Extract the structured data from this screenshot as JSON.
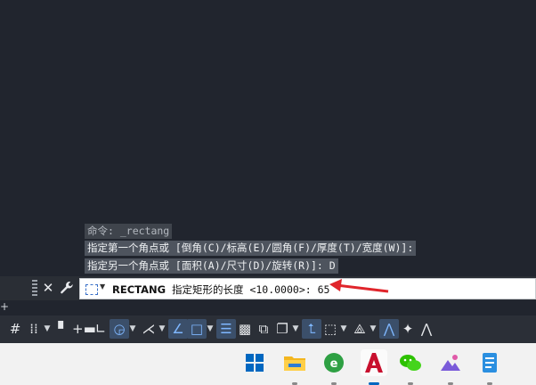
{
  "history": [
    {
      "text": "命令: _rectang",
      "dim": true
    },
    {
      "text": "指定第一个角点或 [倒角(C)/标高(E)/圆角(F)/厚度(T)/宽度(W)]:",
      "dim": false
    },
    {
      "text": "指定另一个角点或 [面积(A)/尺寸(D)/旋转(R)]: D",
      "dim": false
    }
  ],
  "command_line": {
    "command": "RECTANG",
    "prompt": "指定矩形的长度 <10.0000>:",
    "value": "65",
    "close_icon": "close-icon",
    "customize_icon": "wrench-icon"
  },
  "status_bar": [
    {
      "name": "grid-display-icon",
      "glyph": "#",
      "on": false
    },
    {
      "name": "snap-mode-icon",
      "glyph": "⁞⁞",
      "on": false
    },
    {
      "name": "snap-dropdown",
      "glyph": "▼",
      "caret": true
    },
    {
      "name": "infer-constraints-icon",
      "glyph": "▘",
      "on": false
    },
    {
      "name": "dynamic-input-icon",
      "glyph": "+▬",
      "on": false
    },
    {
      "name": "ortho-mode-icon",
      "glyph": "∟",
      "on": false
    },
    {
      "name": "polar-tracking-icon",
      "glyph": "◶",
      "on": true
    },
    {
      "name": "polar-dropdown",
      "glyph": "▼",
      "caret": true
    },
    {
      "name": "isometric-drafting-icon",
      "glyph": "⋌",
      "on": false
    },
    {
      "name": "isometric-dropdown",
      "glyph": "▼",
      "caret": true
    },
    {
      "name": "object-snap-tracking-icon",
      "glyph": "∠",
      "on": true
    },
    {
      "name": "object-snap-icon",
      "glyph": "□",
      "on": true
    },
    {
      "name": "object-snap-dropdown",
      "glyph": "▼",
      "caret": true
    },
    {
      "name": "lineweight-icon",
      "glyph": "☰",
      "on": true
    },
    {
      "name": "transparency-icon",
      "glyph": "▩",
      "on": false
    },
    {
      "name": "selection-cycling-icon",
      "glyph": "⧉",
      "on": false
    },
    {
      "name": "3d-object-snap-icon",
      "glyph": "❐",
      "on": false
    },
    {
      "name": "3d-osnap-dropdown",
      "glyph": "▼",
      "caret": true
    },
    {
      "name": "dynamic-ucs-icon",
      "glyph": "⮤",
      "on": true
    },
    {
      "name": "selection-filter-icon",
      "glyph": "⬚",
      "on": false
    },
    {
      "name": "selection-filter-dropdown",
      "glyph": "▼",
      "caret": true
    },
    {
      "name": "gizmo-icon",
      "glyph": "⟁",
      "on": false
    },
    {
      "name": "gizmo-dropdown",
      "glyph": "▼",
      "caret": true
    },
    {
      "name": "annotation-visibility-icon",
      "glyph": "⋀",
      "on": true
    },
    {
      "name": "auto-scale-icon",
      "glyph": "✦",
      "on": false
    },
    {
      "name": "annotation-scale-icon",
      "glyph": "⋀",
      "on": false
    }
  ],
  "taskbar": [
    {
      "name": "start-icon",
      "active": false
    },
    {
      "name": "file-explorer-icon",
      "active": false
    },
    {
      "name": "browser-icon",
      "active": false
    },
    {
      "name": "autocad-icon",
      "active": true
    },
    {
      "name": "wechat-icon",
      "active": false
    },
    {
      "name": "photos-icon",
      "active": false
    },
    {
      "name": "notepad-icon",
      "active": false
    }
  ],
  "colors": {
    "accent": "#0067c0",
    "arrow": "#e0252b",
    "autocad_red": "#c8102e"
  }
}
